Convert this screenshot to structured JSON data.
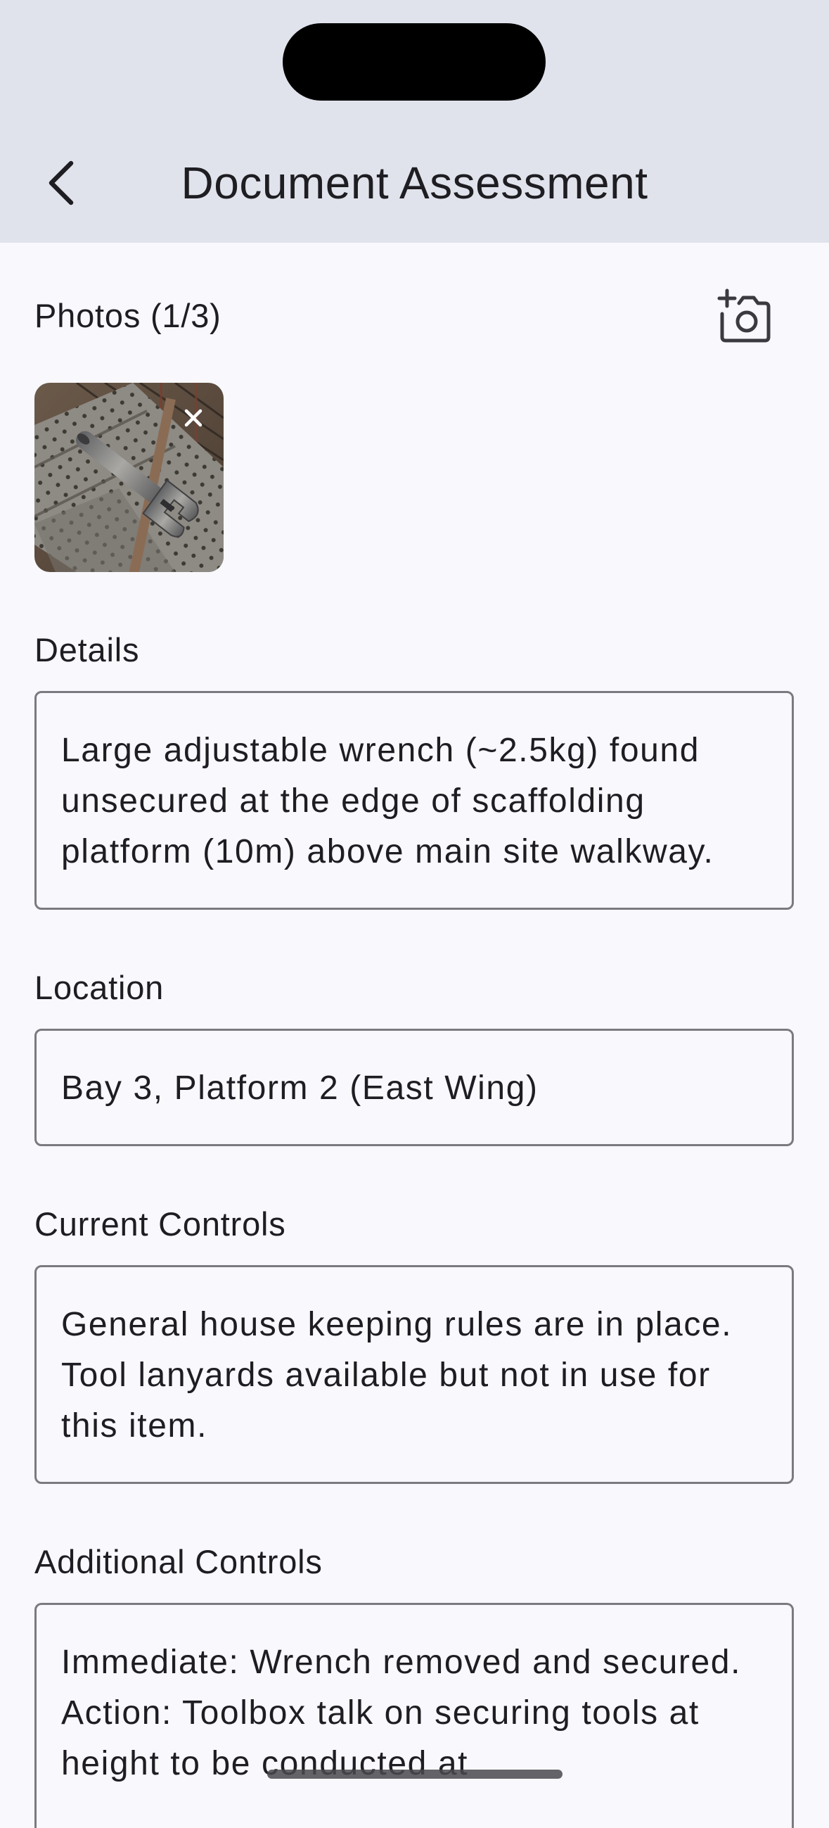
{
  "header": {
    "title": "Document Assessment",
    "back_icon": "chevron-left-icon",
    "background_color": "#e1e3ec"
  },
  "photos": {
    "label": "Photos (1/3)",
    "add_photo_icon": "camera-plus-icon",
    "thumbnail_subject": "adjustable wrench on scaffolding plank",
    "remove_icon": "close-icon"
  },
  "details": {
    "label": "Details",
    "value": "Large adjustable wrench (~2.5kg) found unsecured at the edge of scaffolding platform (10m) above main site walkway."
  },
  "location": {
    "label": "Location",
    "value": "Bay 3, Platform 2 (East Wing)"
  },
  "current_controls": {
    "label": "Current Controls",
    "value": "General house keeping rules are in place. Tool lanyards available but not in use for this item."
  },
  "additional_controls": {
    "label": "Additional Controls",
    "value": "Immediate: Wrench removed and secured. Action: Toolbox talk on securing tools at height to be conducted at"
  },
  "colors": {
    "page_background": "#f8f8fd",
    "field_border": "#7a7a80",
    "text": "#1d1d22"
  }
}
